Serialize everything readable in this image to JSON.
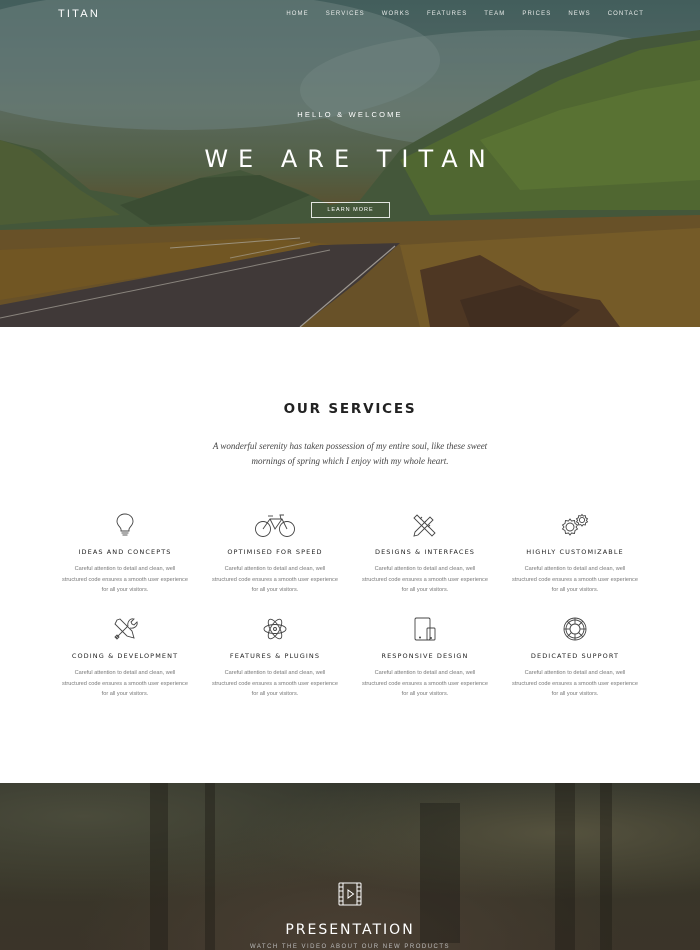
{
  "nav": {
    "brand": "TITAN",
    "links": [
      "HOME",
      "SERVICES",
      "WORKS",
      "FEATURES",
      "TEAM",
      "PRICES",
      "NEWS",
      "CONTACT"
    ]
  },
  "hero": {
    "eyebrow": "HELLO & WELCOME",
    "title": "WE ARE TITAN",
    "cta_label": "LEARN MORE"
  },
  "services": {
    "title": "OUR SERVICES",
    "intro": "A wonderful serenity has taken possession of my entire soul, like these sweet mornings of spring which I enjoy with my whole heart.",
    "items": [
      {
        "icon": "lightbulb-icon",
        "title": "IDEAS AND CONCEPTS",
        "text": "Careful attention to detail and clean, well structured code ensures a smooth user experience for all your visitors."
      },
      {
        "icon": "bicycle-icon",
        "title": "OPTIMISED FOR SPEED",
        "text": "Careful attention to detail and clean, well structured code ensures a smooth user experience for all your visitors."
      },
      {
        "icon": "pencil-ruler-icon",
        "title": "DESIGNS & INTERFACES",
        "text": "Careful attention to detail and clean, well structured code ensures a smooth user experience for all your visitors."
      },
      {
        "icon": "gears-icon",
        "title": "HIGHLY CUSTOMIZABLE",
        "text": "Careful attention to detail and clean, well structured code ensures a smooth user experience for all your visitors."
      },
      {
        "icon": "tools-icon",
        "title": "CODING & DEVELOPMENT",
        "text": "Careful attention to detail and clean, well structured code ensures a smooth user experience for all your visitors."
      },
      {
        "icon": "atom-icon",
        "title": "FEATURES & PLUGINS",
        "text": "Careful attention to detail and clean, well structured code ensures a smooth user experience for all your visitors."
      },
      {
        "icon": "devices-icon",
        "title": "RESPONSIVE DESIGN",
        "text": "Careful attention to detail and clean, well structured code ensures a smooth user experience for all your visitors."
      },
      {
        "icon": "lifebuoy-icon",
        "title": "DEDICATED SUPPORT",
        "text": "Careful attention to detail and clean, well structured code ensures a smooth user experience for all your visitors."
      }
    ]
  },
  "presentation": {
    "icon": "video-play-icon",
    "title": "PRESENTATION",
    "subtitle": "WATCH THE VIDEO ABOUT OUR NEW PRODUCTS"
  }
}
